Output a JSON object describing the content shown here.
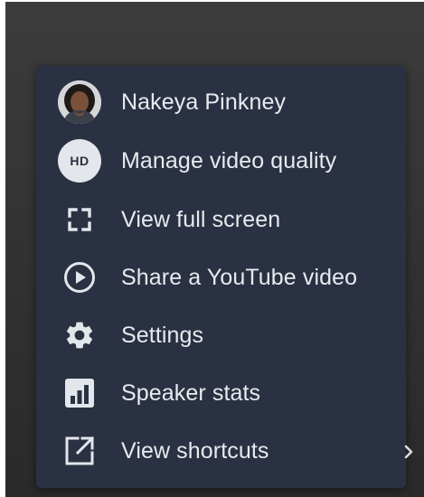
{
  "menu": {
    "items": [
      {
        "label": "Nakeya Pinkney",
        "icon": "avatar"
      },
      {
        "label": "Manage video quality",
        "icon": "hd-icon",
        "badge": "HD"
      },
      {
        "label": "View full screen",
        "icon": "fullscreen-icon"
      },
      {
        "label": "Share a YouTube video",
        "icon": "play-circle-icon"
      },
      {
        "label": "Settings",
        "icon": "gear-icon"
      },
      {
        "label": "Speaker stats",
        "icon": "bar-chart-icon"
      },
      {
        "label": "View shortcuts",
        "icon": "external-link-icon"
      }
    ],
    "more_indicator": "chevron-right-icon"
  },
  "colors": {
    "menu_background": "#2a3142",
    "text": "#e8eaee",
    "icon": "#e3e6eb",
    "backdrop": "#333333"
  }
}
